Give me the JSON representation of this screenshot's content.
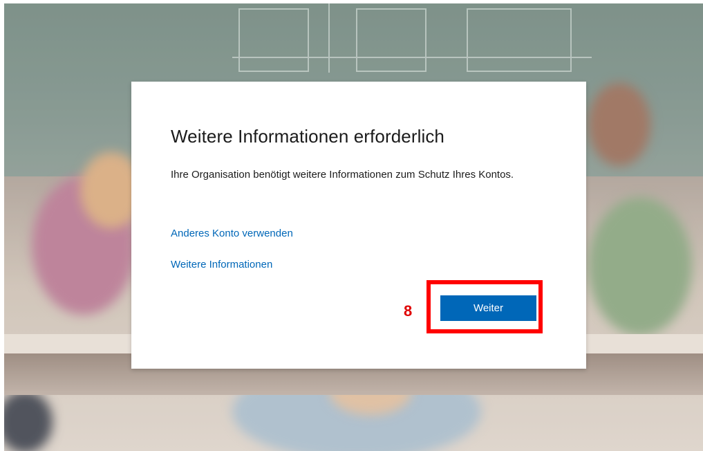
{
  "dialog": {
    "title": "Weitere Informationen erforderlich",
    "description": "Ihre Organisation benötigt weitere Informationen zum Schutz Ihres Kontos.",
    "links": {
      "use_other_account": "Anderes Konto verwenden",
      "more_info": "Weitere Informationen"
    },
    "next_button": "Weiter"
  },
  "annotation": {
    "step_number": "8",
    "highlight_color": "#ff0000"
  },
  "colors": {
    "accent": "#0067b8",
    "link": "#0067b8",
    "text": "#1b1b1b"
  }
}
